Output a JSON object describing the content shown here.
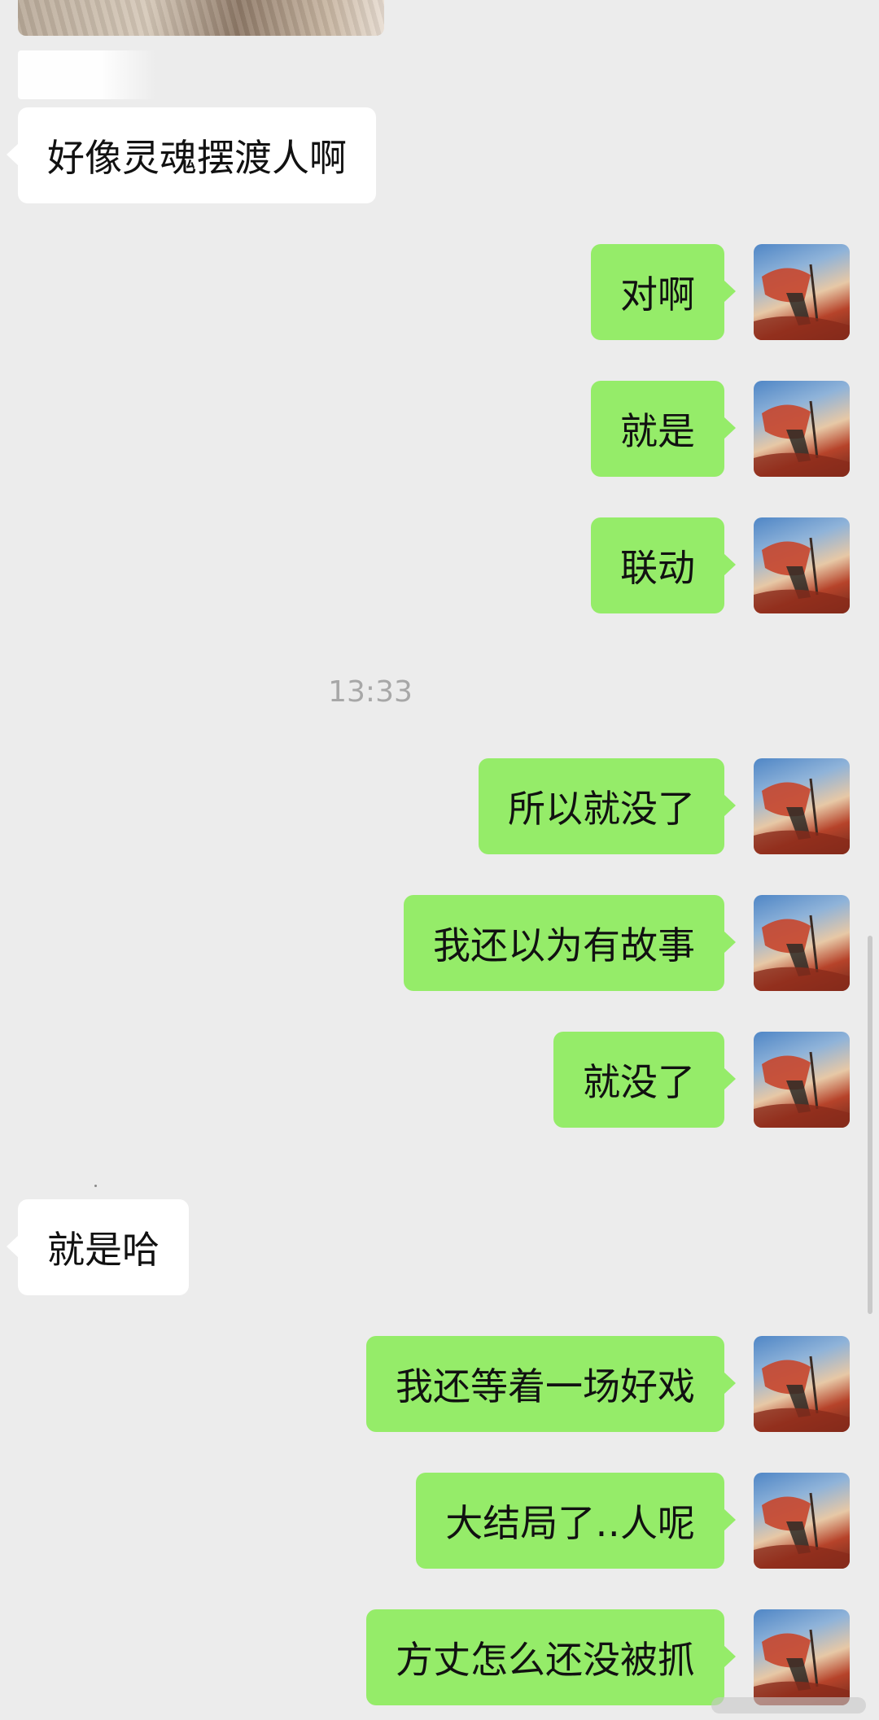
{
  "chat": {
    "timestamp": "13:33",
    "messages": [
      {
        "side": "in",
        "text": "好像灵魂摆渡人啊"
      },
      {
        "side": "out",
        "text": "对啊"
      },
      {
        "side": "out",
        "text": "就是"
      },
      {
        "side": "out",
        "text": "联动"
      },
      {
        "side": "out",
        "text": "所以就没了"
      },
      {
        "side": "out",
        "text": "我还以为有故事"
      },
      {
        "side": "out",
        "text": "就没了"
      },
      {
        "side": "in",
        "text": "就是哈"
      },
      {
        "side": "out",
        "text": "我还等着一场好戏"
      },
      {
        "side": "out",
        "text": "大结局了‥人呢"
      },
      {
        "side": "out",
        "text": "方丈怎么还没被抓"
      }
    ]
  },
  "colors": {
    "background": "#ececec",
    "outgoing_bubble": "#95ec69",
    "incoming_bubble": "#ffffff",
    "timestamp_text": "#a7a7a7"
  },
  "icons": {
    "avatar": "user-avatar-photo",
    "image_message": "photo-thumbnail"
  }
}
